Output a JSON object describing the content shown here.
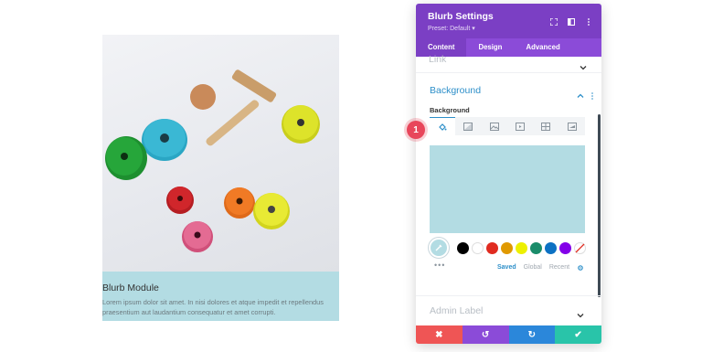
{
  "blurb": {
    "title": "Blurb Module",
    "text": "Lorem ipsum dolor sit amet. In nisi dolores et atque impedit et repellendus praesentium aut laudantium consequatur et amet corrupti.",
    "background_color": "#b3dce3"
  },
  "panel": {
    "title": "Blurb Settings",
    "preset": "Preset: Default ▾",
    "header_color": "#7b3fc4",
    "tabs": [
      "Content",
      "Design",
      "Advanced"
    ],
    "active_tab": "Content",
    "sections": {
      "link": "Link",
      "background": "Background",
      "background_label": "Background",
      "admin_label": "Admin Label"
    },
    "background_types": [
      "color-icon",
      "gradient-icon",
      "image-icon",
      "video-icon",
      "pattern-icon",
      "mask-icon"
    ],
    "selected_color": "#b3dce3",
    "swatches": [
      "#000000",
      "#ffffff",
      "#e02b20",
      "#e09900",
      "#edf000",
      "#7cda24",
      "#0c71c3",
      "#8300e9"
    ],
    "swatch_tabs": [
      "Saved",
      "Global",
      "Recent"
    ],
    "more": "•••",
    "footer": {
      "cancel": "✖",
      "undo": "↺",
      "redo": "↻",
      "save": "✔"
    }
  },
  "badge": "1",
  "colors": {
    "accent_blue": "#2d8fc9",
    "cancel": "#ef5555",
    "undo": "#8b4bd8",
    "redo": "#2b87da",
    "save": "#29c4a9",
    "badge": "#e8465b"
  }
}
